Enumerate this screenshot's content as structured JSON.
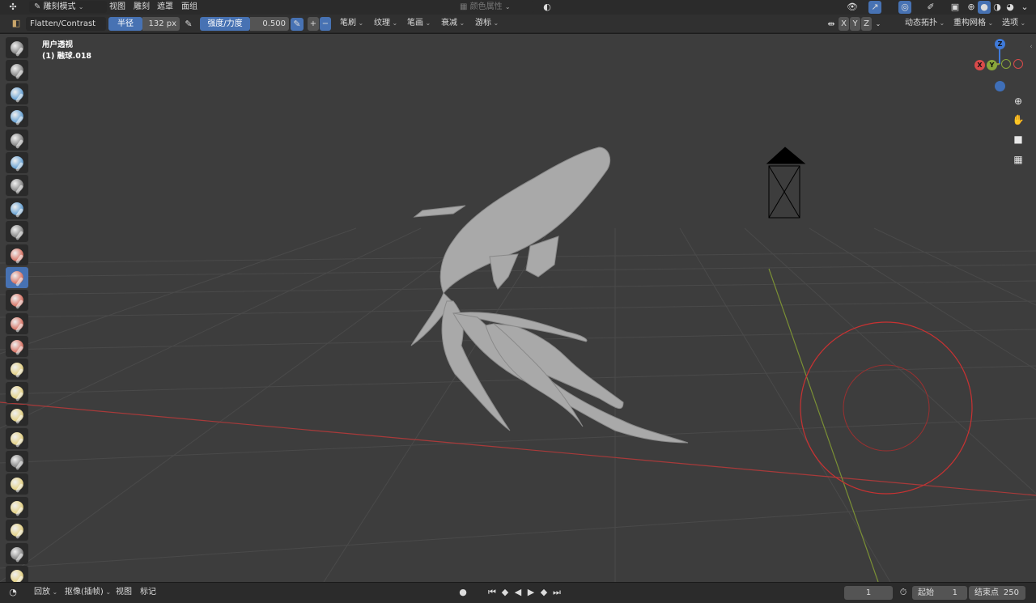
{
  "topbar": {
    "mode": "雕刻模式",
    "menus": [
      "视图",
      "雕刻",
      "遮罩",
      "面组"
    ],
    "color_attribute": "颜色属性"
  },
  "toolheader": {
    "brush_name": "Flatten/Contrast",
    "radius_label": "半径",
    "radius_value": "132 px",
    "strength_label": "强度/力度",
    "strength_value": "0.500",
    "plus": "+",
    "minus": "−",
    "menus": [
      "笔刷",
      "纹理",
      "笔画",
      "衰减",
      "游标"
    ],
    "axes": [
      "X",
      "Y",
      "Z"
    ],
    "dyntopo": "动态拓扑",
    "remesh": "重构网格",
    "options": "选项"
  },
  "viewport": {
    "view_name": "用户透视",
    "object_name": "(1) 融球.018",
    "gizmo": {
      "z": "Z",
      "y": "Y",
      "x": "X"
    }
  },
  "lefttools": {
    "colors": [
      "#8a8a8a",
      "#8a8a8a",
      "#6fa7d6",
      "#6fa7d6",
      "#8a8a8a",
      "#6fa7d6",
      "#8a8a8a",
      "#6fa7d6",
      "#8a8a8a",
      "#d97a6c",
      "#d97a6c",
      "#d97a6c",
      "#d97a6c",
      "#d97a6c",
      "#e5d38a",
      "#e5d38a",
      "#e5d38a",
      "#e5d38a",
      "#8a8a8a",
      "#e5d38a",
      "#e5d38a",
      "#e5d38a",
      "#8a8a8a",
      "#e5d38a"
    ],
    "active_index": 10
  },
  "timeline": {
    "playback": "回放",
    "keying": "抠像(插帧)",
    "view": "视图",
    "marker": "标记",
    "current_frame": "1",
    "start_label": "起始",
    "start_value": "1",
    "end_label": "结束点",
    "end_value": "250"
  },
  "colors": {
    "accent": "#4772b3",
    "x_axis": "#d94a4a",
    "y_axis": "#8aa63a",
    "z_axis": "#3f7ad9",
    "brush_cursor": "#c83232"
  }
}
